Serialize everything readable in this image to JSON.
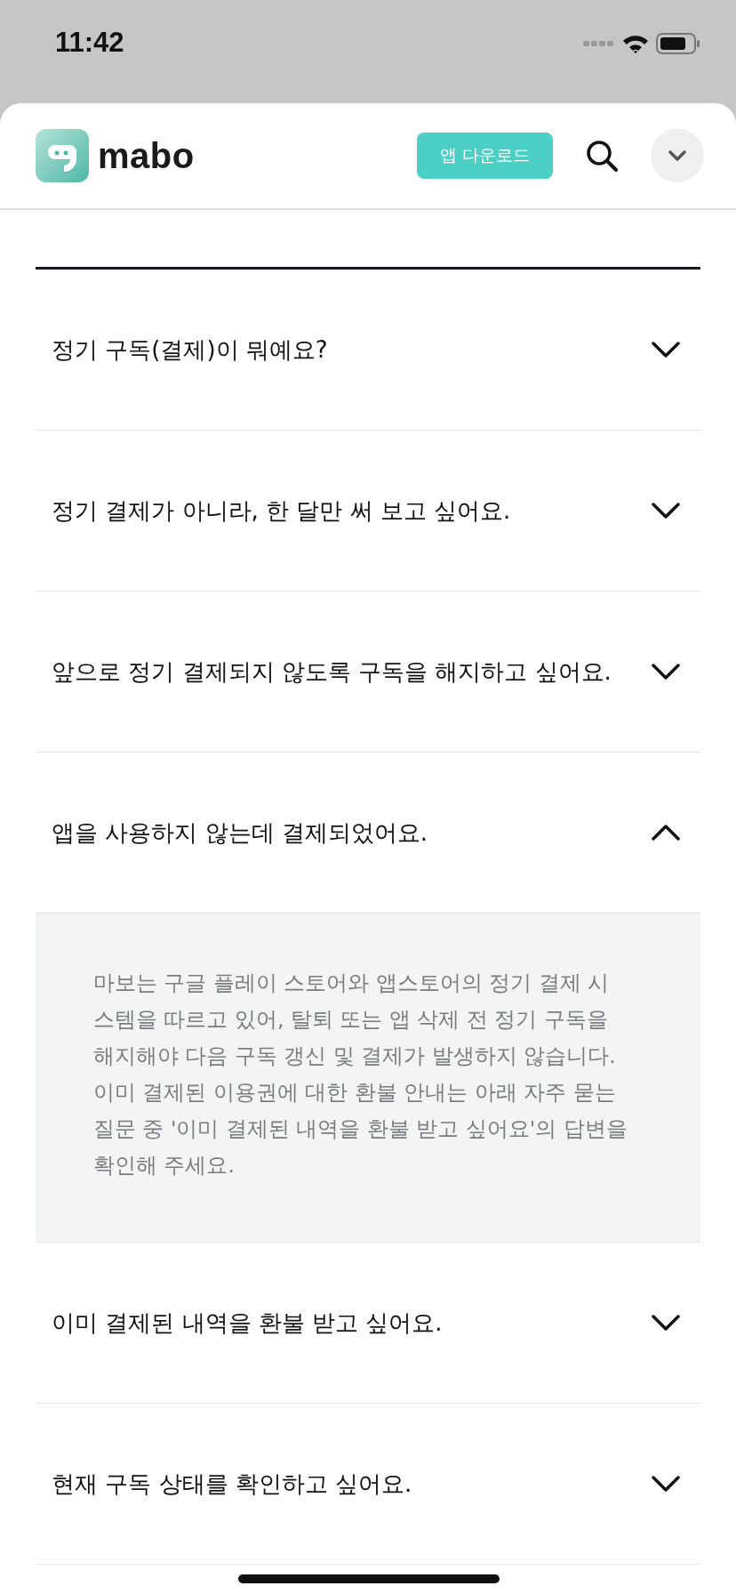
{
  "status_bar": {
    "time": "11:42"
  },
  "header": {
    "logo_text": "mabo",
    "download_button": "앱 다운로드"
  },
  "faq": [
    {
      "question": "정기 구독(결제)이 뭐예요?",
      "expanded": false
    },
    {
      "question": "정기 결제가 아니라, 한 달만 써 보고 싶어요.",
      "expanded": false
    },
    {
      "question": "앞으로 정기 결제되지 않도록 구독을 해지하고 싶어요.",
      "expanded": false
    },
    {
      "question": "앱을 사용하지 않는데 결제되었어요.",
      "expanded": true,
      "answer": "마보는 구글 플레이 스토어와 앱스토어의 정기 결제 시스템을 따르고 있어, 탈퇴 또는 앱 삭제 전 정기 구독을 해지해야 다음 구독 갱신 및 결제가 발생하지 않습니다. 이미 결제된 이용권에 대한 환불 안내는 아래 자주 묻는 질문 중 '이미 결제된 내역을 환불 받고 싶어요'의 답변을 확인해 주세요."
    },
    {
      "question": "이미 결제된 내역을 환불 받고 싶어요.",
      "expanded": false
    },
    {
      "question": "현재 구독 상태를 확인하고 싶어요.",
      "expanded": false
    }
  ]
}
